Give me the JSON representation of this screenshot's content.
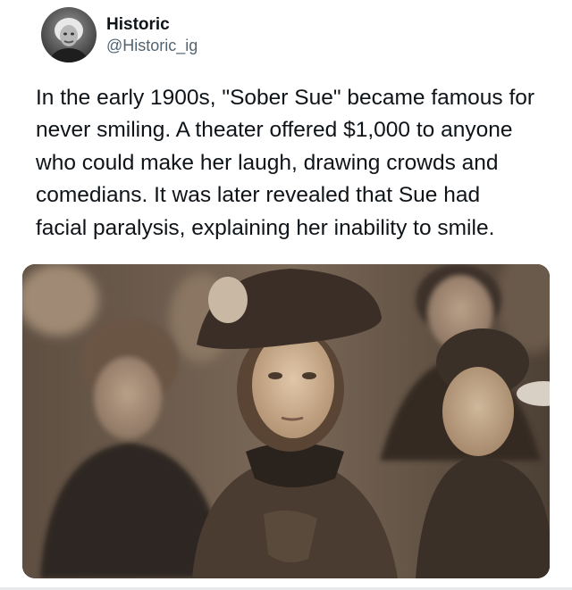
{
  "author": {
    "display_name": "Historic",
    "handle": "@Historic_ig",
    "avatar_icon": "avatar-portrait-icon"
  },
  "tweet": {
    "text": "In the early 1900s, \"Sober Sue\" became famous for\nnever smiling. A theater offered $1,000 to anyone\nwho could make her laugh, drawing crowds and\ncomedians. It was later revealed that Sue had\nfacial paralysis, explaining her inability to smile."
  },
  "media": {
    "type": "sepia-photograph"
  },
  "colors": {
    "text": "#0f1419",
    "secondary_text": "#536471",
    "photo_tone": "#6d5c4c"
  }
}
